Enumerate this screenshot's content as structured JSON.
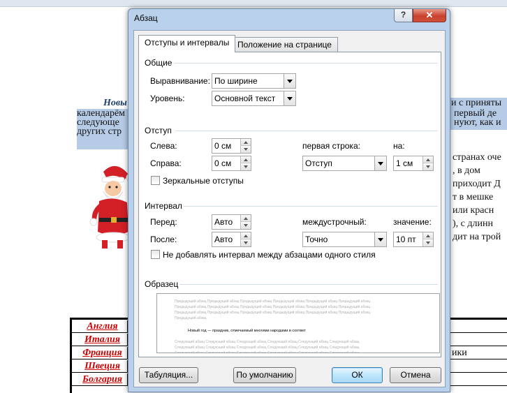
{
  "document": {
    "para_bold_start": "Новы",
    "para_right_1": "и с приняты",
    "para_line_2_left": "календарём",
    "para_line_2_right": "первый де",
    "para_line_3_left": "следующе",
    "para_line_3_right": "нуют, как и",
    "para_line_4_left": "других стр",
    "body_lines": [
      "странах оче",
      ",  в  дом",
      "приходит Д",
      "т в мешке",
      "или красн",
      "), с длинн",
      "дит на трой"
    ],
    "table": {
      "rows": [
        {
          "country": "Англия",
          "right": ""
        },
        {
          "country": "Италия",
          "right": ""
        },
        {
          "country": "Франция",
          "right": "ики"
        },
        {
          "country": "Швеция",
          "right": ""
        },
        {
          "country": "Болгария",
          "right": ""
        }
      ]
    }
  },
  "dialog": {
    "title": "Абзац",
    "help_button": "?",
    "close_button": "✕",
    "tabs": [
      "Отступы и интервалы",
      "Положение на странице"
    ],
    "general": {
      "group": "Общие",
      "alignment_label": "Выравнивание:",
      "alignment_value": "По ширине",
      "level_label": "Уровень:",
      "level_value": "Основной текст"
    },
    "indent": {
      "group": "Отступ",
      "left_label": "Слева:",
      "left_value": "0 см",
      "right_label": "Справа:",
      "right_value": "0 см",
      "first_line_label": "первая строка:",
      "first_line_value": "Отступ",
      "by_label": "на:",
      "by_value": "1 см",
      "mirror_label": "Зеркальные отступы"
    },
    "spacing": {
      "group": "Интервал",
      "before_label": "Перед:",
      "before_value": "Авто",
      "after_label": "После:",
      "after_value": "Авто",
      "line_label": "междустрочный:",
      "line_value": "Точно",
      "at_label": "значение:",
      "at_value": "10 пт",
      "dont_add_label": "Не добавлять интервал между абзацами одного стиля"
    },
    "preview": {
      "group": "Образец",
      "prev_line": "Предыдущий абзац Предыдущий абзац Предыдущий абзац Предыдущий абзац Предыдущий абзац Предыдущий абзац",
      "prev_short": "Предыдущий абзац",
      "sample": "Новый год — праздник, отмечаемый многими народами в соответ",
      "next_line": "Следующий абзац Следующий абзац Следующий абзац Следующий абзац Следующий абзац Следующий абзац"
    },
    "buttons": {
      "tabs": "Табуляция...",
      "default": "По умолчанию",
      "ok": "ОК",
      "cancel": "Отмена"
    }
  }
}
